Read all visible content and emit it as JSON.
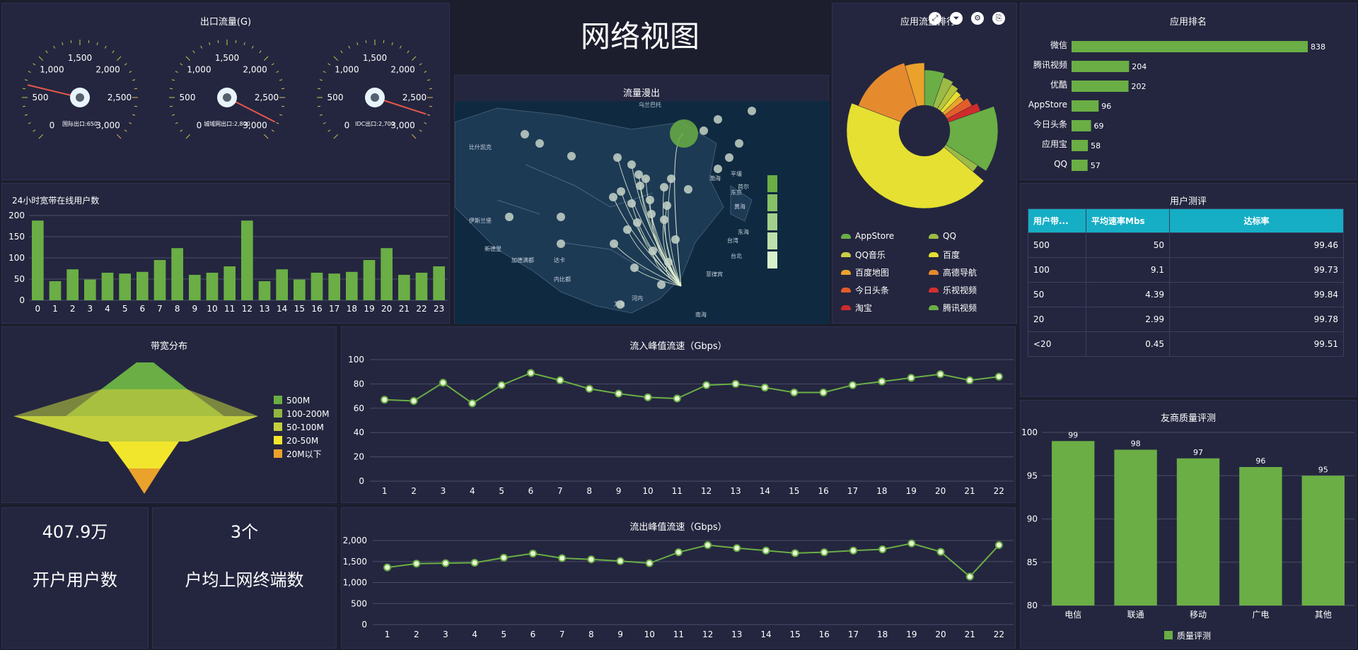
{
  "header": {
    "title": "网络视图"
  },
  "gauges": {
    "title": "出口流量(G)",
    "ticks": [
      "0",
      "500",
      "1,000",
      "1,500",
      "2,000",
      "2,500",
      "3,000"
    ],
    "items": [
      {
        "label": "国际出口:650",
        "value": 650
      },
      {
        "label": "城域网出口:2,800",
        "value": 2800
      },
      {
        "label": "IDC出口:2,700",
        "value": 2700
      }
    ],
    "max": 3000
  },
  "map": {
    "title": "流量漫出",
    "labels": [
      "乌兰巴托",
      "比什凯克",
      "伊斯兰堡",
      "新德里",
      "加德满都",
      "达卡",
      "内比都",
      "河内",
      "万象",
      "南海",
      "东京",
      "首尔",
      "平壤",
      "渤海",
      "黄海",
      "东海",
      "台北",
      "台湾",
      "菲律宾"
    ]
  },
  "app_flow": {
    "title": "应用流量排行",
    "legend": [
      "AppStore",
      "QQ",
      "QQ音乐",
      "百度",
      "百度地图",
      "高德导航",
      "今日头条",
      "乐视视频",
      "淘宝",
      "腾讯视频"
    ],
    "toolbar": [
      "restore-icon",
      "filter-icon",
      "settings-icon",
      "export-icon"
    ]
  },
  "app_rank": {
    "title": "应用排名"
  },
  "online_users": {
    "title": "24小时宽带在线用户数"
  },
  "user_eval": {
    "title": "用户测评",
    "headers": [
      "用户带...",
      "平均速率Mbs",
      "达标率"
    ],
    "rows": [
      [
        "500",
        "50",
        "99.46"
      ],
      [
        "100",
        "9.1",
        "99.73"
      ],
      [
        "50",
        "4.39",
        "99.84"
      ],
      [
        "20",
        "2.99",
        "99.78"
      ],
      [
        "<20",
        "0.45",
        "99.51"
      ]
    ]
  },
  "bandwidth": {
    "title": "带宽分布",
    "legend": [
      "500M",
      "100-200M",
      "50-100M",
      "20-50M",
      "20M以下"
    ]
  },
  "inbound": {
    "title": "流入峰值流速（Gbps）"
  },
  "outbound": {
    "title": "流出峰值流速（Gbps）"
  },
  "vendor": {
    "title": "友商质量评测",
    "legend": "质量评测"
  },
  "stats": [
    {
      "value": "407.9万",
      "label": "开户用户数"
    },
    {
      "value": "3个",
      "label": "户均上网终端数"
    }
  ],
  "chart_data": [
    {
      "type": "bar",
      "title": "应用排名",
      "categories": [
        "微信",
        "腾讯视频",
        "优酷",
        "AppStore",
        "今日头条",
        "应用宝",
        "QQ"
      ],
      "values": [
        838,
        204,
        202,
        96,
        69,
        58,
        57
      ]
    },
    {
      "type": "bar",
      "title": "24小时宽带在线用户数",
      "categories": [
        "0",
        "1",
        "2",
        "3",
        "4",
        "5",
        "6",
        "7",
        "8",
        "9",
        "10",
        "11",
        "12",
        "13",
        "14",
        "15",
        "16",
        "17",
        "18",
        "19",
        "20",
        "21",
        "22",
        "23"
      ],
      "values": [
        188,
        45,
        73,
        49,
        65,
        63,
        67,
        95,
        123,
        60,
        65,
        80,
        188,
        45,
        73,
        49,
        65,
        63,
        67,
        95,
        123,
        60,
        65,
        80
      ],
      "ylim": [
        0,
        200
      ],
      "yticks": [
        0,
        50,
        100,
        150,
        200
      ]
    },
    {
      "type": "line",
      "title": "流入峰值流速（Gbps）",
      "categories": [
        "1",
        "2",
        "3",
        "4",
        "5",
        "6",
        "7",
        "8",
        "9",
        "10",
        "11",
        "12",
        "13",
        "14",
        "15",
        "16",
        "17",
        "18",
        "19",
        "20",
        "21",
        "22"
      ],
      "values": [
        67,
        66,
        81,
        64,
        79,
        89,
        83,
        76,
        72,
        69,
        68,
        79,
        80,
        77,
        73,
        73,
        79,
        82,
        85,
        88,
        83,
        86
      ],
      "ylim": [
        0,
        100
      ],
      "yticks": [
        0,
        20,
        40,
        60,
        80,
        100
      ]
    },
    {
      "type": "line",
      "title": "流出峰值流速（Gbps）",
      "categories": [
        "1",
        "2",
        "3",
        "4",
        "5",
        "6",
        "7",
        "8",
        "9",
        "10",
        "11",
        "12",
        "13",
        "14",
        "15",
        "16",
        "17",
        "18",
        "19",
        "20",
        "21",
        "22"
      ],
      "values": [
        1360,
        1450,
        1460,
        1470,
        1590,
        1690,
        1580,
        1550,
        1510,
        1460,
        1720,
        1890,
        1820,
        1760,
        1700,
        1720,
        1760,
        1790,
        1930,
        1730,
        1140,
        1890
      ],
      "ylim": [
        0,
        2000
      ],
      "yticks": [
        "0",
        "500",
        "1,000",
        "1,500",
        "2,000"
      ]
    },
    {
      "type": "bar",
      "title": "友商质量评测",
      "categories": [
        "电信",
        "联通",
        "移动",
        "广电",
        "其他"
      ],
      "values": [
        99,
        98,
        97,
        96,
        95
      ],
      "ylim": [
        80,
        100
      ],
      "yticks": [
        80,
        85,
        90,
        95,
        100
      ],
      "series": [
        {
          "name": "质量评测",
          "values": [
            99,
            98,
            97,
            96,
            95
          ]
        }
      ]
    },
    {
      "type": "pie",
      "title": "应用流量排行",
      "categories": [
        "AppStore",
        "QQ",
        "QQ音乐",
        "百度",
        "百度地图",
        "高德导航",
        "今日头条",
        "乐视视频",
        "淘宝",
        "腾讯视频"
      ],
      "values": [
        4,
        3,
        2,
        36,
        4,
        12,
        4,
        4,
        3,
        28
      ]
    }
  ],
  "colors": {
    "green": "#6aae45",
    "panel": "#24263f",
    "cyan": "#15aec5",
    "needle": "#e8574a"
  }
}
